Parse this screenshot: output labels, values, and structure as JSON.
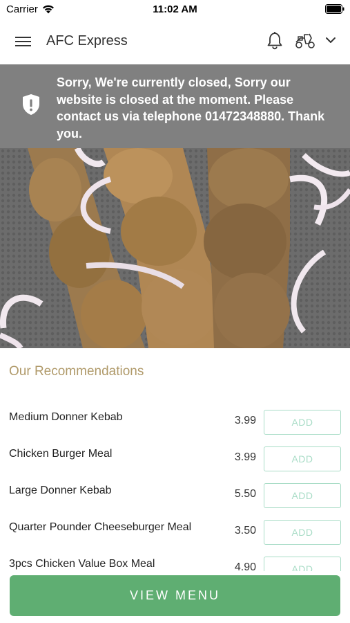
{
  "status_bar": {
    "carrier": "Carrier",
    "time": "11:02 AM"
  },
  "nav": {
    "title": "AFC Express",
    "icons": [
      "menu-icon",
      "bell-icon",
      "scooter-icon",
      "chevron-down-icon"
    ]
  },
  "banner": {
    "message": "Sorry, We're currently closed, Sorry our website is closed at the moment. Please contact us via telephone 01472348880. Thank you.",
    "icon": "shield-icon",
    "background": "#808080"
  },
  "hero": {
    "icon": "kebab-skewers-photo"
  },
  "recommendations": {
    "title": "Our Recommendations",
    "items": [
      {
        "name": "Medium Donner Kebab",
        "price": "3.99",
        "button": "ADD"
      },
      {
        "name": "Chicken Burger Meal",
        "price": "3.99",
        "button": "ADD"
      },
      {
        "name": "Large Donner Kebab",
        "price": "5.50",
        "button": "ADD"
      },
      {
        "name": "Quarter Pounder Cheeseburger Meal",
        "price": "3.50",
        "button": "ADD"
      },
      {
        "name": "3pcs Chicken Value Box Meal",
        "price": "4.90",
        "button": "ADD"
      }
    ]
  },
  "footer": {
    "view_menu_label": "VIEW MENU"
  },
  "colors": {
    "accent_green": "#5fae72",
    "add_outline": "#a8dcc6",
    "section_title": "#b09a6a"
  }
}
